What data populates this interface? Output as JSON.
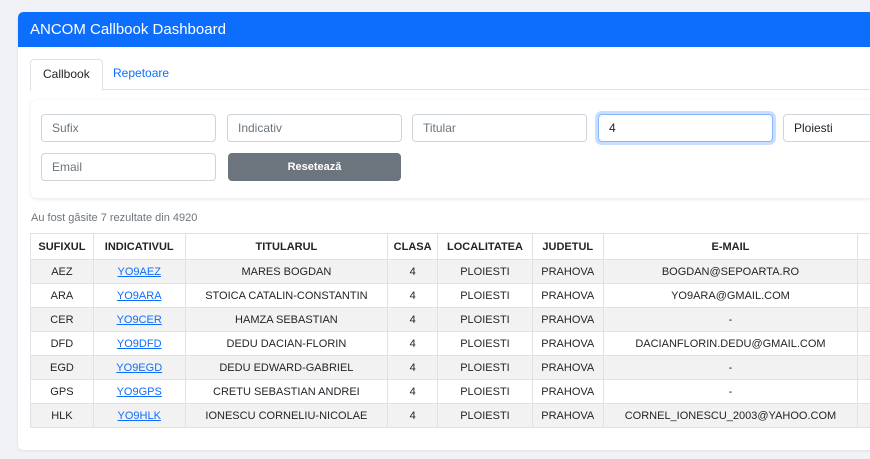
{
  "header": {
    "title": "ANCOM Callbook Dashboard"
  },
  "tabs": [
    {
      "label": "Callbook",
      "active": true
    },
    {
      "label": "Repetoare",
      "active": false
    }
  ],
  "filters": {
    "sufix_placeholder": "Sufix",
    "indicativ_placeholder": "Indicativ",
    "titular_placeholder": "Titular",
    "clasa_value": "4",
    "localitate_value": "Ploiesti",
    "email_placeholder": "Email",
    "reset_label": "Resetează"
  },
  "results_text": "Au fost găsite 7 rezultate din 4920",
  "table": {
    "headers": [
      "SUFIXUL",
      "INDICATIVUL",
      "TITULARUL",
      "CLASA",
      "LOCALITATEA",
      "JUDETUL",
      "E-MAIL"
    ],
    "rows": [
      [
        "AEZ",
        "YO9AEZ",
        "MARES BOGDAN",
        "4",
        "PLOIESTI",
        "PRAHOVA",
        "BOGDAN@SEPOARTA.RO"
      ],
      [
        "ARA",
        "YO9ARA",
        "STOICA CATALIN-CONSTANTIN",
        "4",
        "PLOIESTI",
        "PRAHOVA",
        "YO9ARA@GMAIL.COM"
      ],
      [
        "CER",
        "YO9CER",
        "HAMZA SEBASTIAN",
        "4",
        "PLOIESTI",
        "PRAHOVA",
        "-"
      ],
      [
        "DFD",
        "YO9DFD",
        "DEDU DACIAN-FLORIN",
        "4",
        "PLOIESTI",
        "PRAHOVA",
        "DACIANFLORIN.DEDU@GMAIL.COM"
      ],
      [
        "EGD",
        "YO9EGD",
        "DEDU EDWARD-GABRIEL",
        "4",
        "PLOIESTI",
        "PRAHOVA",
        "-"
      ],
      [
        "GPS",
        "YO9GPS",
        "CRETU SEBASTIAN ANDREI",
        "4",
        "PLOIESTI",
        "PRAHOVA",
        "-"
      ],
      [
        "HLK",
        "YO9HLK",
        "IONESCU CORNELIU-NICOLAE",
        "4",
        "PLOIESTI",
        "PRAHOVA",
        "CORNEL_IONESCU_2003@YAHOO.COM"
      ]
    ]
  },
  "colors": {
    "primary": "#0d6efd",
    "secondary": "#6c757d",
    "stripe": "#f2f2f2"
  }
}
